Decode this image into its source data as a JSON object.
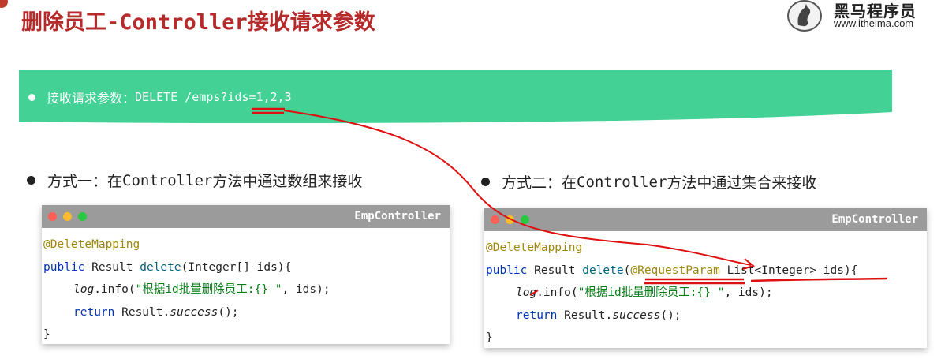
{
  "slide": {
    "title": "删除员工-Controller接收请求参数"
  },
  "logo": {
    "name": "黑马程序员",
    "url": "www.itheima.com"
  },
  "banner": {
    "label": "接收请求参数：",
    "request": "DELETE /emps?ids=1,2,3"
  },
  "method_one": {
    "label": "方式一：在",
    "mono": "Controller",
    "rest": "方法中通过数组来接收"
  },
  "method_two": {
    "label": "方式二：在",
    "mono": "Controller",
    "rest": "方法中通过集合来接收"
  },
  "code_one": {
    "filename": "EmpController",
    "annotation": "@DeleteMapping",
    "public": "public",
    "result_type": " Result ",
    "method": "delete",
    "params": "(Integer[] ids){",
    "log": "log",
    "info_call": ".info(",
    "log_string": "\"根据id批量删除员工:{} \"",
    "log_args": ", ids);",
    "return_kw": "return",
    "return_call": " Result.",
    "success": "success",
    "return_end": "();",
    "close_brace": "}"
  },
  "code_two": {
    "filename": "EmpController",
    "annotation": "@DeleteMapping",
    "public": "public",
    "result_type": " Result ",
    "method": "delete",
    "open_paren": "(",
    "param_annotation": "@RequestParam",
    "params": " List<Integer> ids){",
    "log": "log",
    "info_call": ".info(",
    "log_string": "\"根据id批量删除员工:{} \"",
    "log_args": ", ids);",
    "return_kw": "return",
    "return_call": " Result.",
    "success": "success",
    "return_end": "();",
    "close_brace": "}"
  },
  "colors": {
    "title": "#b52a2a",
    "banner": "#43d195",
    "annotation_red": "#dd1111"
  }
}
